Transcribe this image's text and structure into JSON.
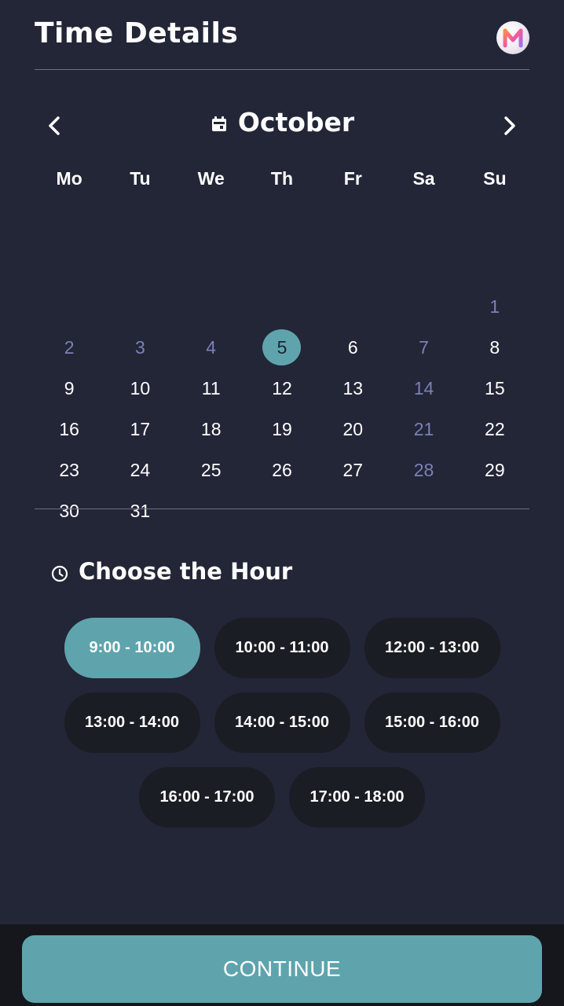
{
  "header": {
    "title": "Time Details",
    "avatar_letter": "M"
  },
  "calendar": {
    "month": "October",
    "prev_icon": "chevron-left-icon",
    "next_icon": "chevron-right-icon",
    "month_icon": "calendar-icon",
    "weekdays": [
      "Mo",
      "Tu",
      "We",
      "Th",
      "Fr",
      "Sa",
      "Su"
    ],
    "selected_day": "5",
    "weeks": [
      [
        {
          "d": "",
          "s": "empty"
        },
        {
          "d": "",
          "s": "empty"
        },
        {
          "d": "",
          "s": "empty"
        },
        {
          "d": "",
          "s": "empty"
        },
        {
          "d": "",
          "s": "empty"
        },
        {
          "d": "",
          "s": "empty"
        },
        {
          "d": "",
          "s": "empty"
        }
      ],
      [
        {
          "d": "",
          "s": "empty"
        },
        {
          "d": "",
          "s": "empty"
        },
        {
          "d": "",
          "s": "empty"
        },
        {
          "d": "",
          "s": "empty"
        },
        {
          "d": "",
          "s": "empty"
        },
        {
          "d": "",
          "s": "empty"
        },
        {
          "d": "1",
          "s": "muted"
        }
      ],
      [
        {
          "d": "2",
          "s": "muted"
        },
        {
          "d": "3",
          "s": "muted"
        },
        {
          "d": "4",
          "s": "muted"
        },
        {
          "d": "5",
          "s": "selected"
        },
        {
          "d": "6",
          "s": "normal"
        },
        {
          "d": "7",
          "s": "muted"
        },
        {
          "d": "8",
          "s": "normal"
        }
      ],
      [
        {
          "d": "9",
          "s": "normal"
        },
        {
          "d": "10",
          "s": "normal"
        },
        {
          "d": "11",
          "s": "normal"
        },
        {
          "d": "12",
          "s": "normal"
        },
        {
          "d": "13",
          "s": "normal"
        },
        {
          "d": "14",
          "s": "muted"
        },
        {
          "d": "15",
          "s": "normal"
        }
      ],
      [
        {
          "d": "16",
          "s": "normal"
        },
        {
          "d": "17",
          "s": "normal"
        },
        {
          "d": "18",
          "s": "normal"
        },
        {
          "d": "19",
          "s": "normal"
        },
        {
          "d": "20",
          "s": "normal"
        },
        {
          "d": "21",
          "s": "muted"
        },
        {
          "d": "22",
          "s": "normal"
        }
      ],
      [
        {
          "d": "23",
          "s": "normal"
        },
        {
          "d": "24",
          "s": "normal"
        },
        {
          "d": "25",
          "s": "normal"
        },
        {
          "d": "26",
          "s": "normal"
        },
        {
          "d": "27",
          "s": "normal"
        },
        {
          "d": "28",
          "s": "muted"
        },
        {
          "d": "29",
          "s": "normal"
        }
      ],
      [
        {
          "d": "30",
          "s": "normal"
        },
        {
          "d": "31",
          "s": "normal"
        },
        {
          "d": "",
          "s": "empty"
        },
        {
          "d": "",
          "s": "empty"
        },
        {
          "d": "",
          "s": "empty"
        },
        {
          "d": "",
          "s": "empty"
        },
        {
          "d": "",
          "s": "empty"
        }
      ]
    ]
  },
  "hours": {
    "title": "Choose the Hour",
    "icon": "clock-icon",
    "slot_rows": [
      [
        {
          "label": "9:00 - 10:00",
          "active": true
        },
        {
          "label": "10:00 - 11:00",
          "active": false
        },
        {
          "label": "12:00 - 13:00",
          "active": false
        }
      ],
      [
        {
          "label": "13:00 - 14:00",
          "active": false
        },
        {
          "label": "14:00 - 15:00",
          "active": false
        },
        {
          "label": "15:00 - 16:00",
          "active": false
        }
      ],
      [
        {
          "label": "16:00 - 17:00",
          "active": false
        },
        {
          "label": "17:00 - 18:00",
          "active": false
        }
      ]
    ]
  },
  "footer": {
    "continue_label": "CONTINUE"
  },
  "colors": {
    "background": "#222637",
    "accent": "#5fa4ad",
    "muted_day": "#7c80b5",
    "slot_bg": "#1b1d24",
    "footer_bg": "#15171d"
  }
}
